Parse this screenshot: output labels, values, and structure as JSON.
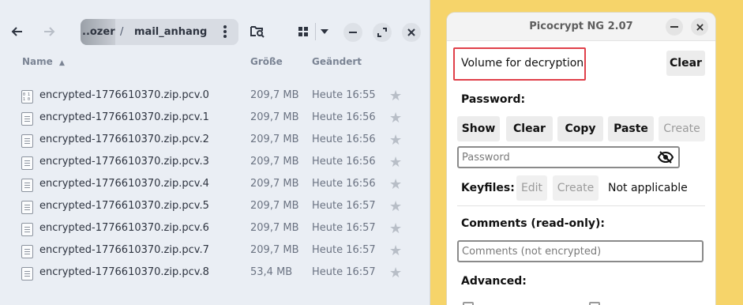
{
  "file_manager": {
    "breadcrumb": {
      "parent": "..ozer",
      "separator": "/",
      "current": "mail_anhang"
    },
    "icons": {
      "back": "arrow-left-icon",
      "forward": "arrow-right-icon",
      "menu": "kebab-menu-icon",
      "search": "search-folder-icon",
      "view": "grid-view-icon",
      "view_dropdown": "chevron-down-icon",
      "minimize": "minimize-icon",
      "maximize": "maximize-icon",
      "close": "close-icon"
    },
    "columns": {
      "name": "Name",
      "size": "Größe",
      "modified": "Geändert",
      "sort_indicator": "▲"
    },
    "files": [
      {
        "name": "encrypted-1776610370.zip.pcv.0",
        "size": "209,7 MB",
        "modified": "Heute 16:55",
        "icon": "binary-file-icon"
      },
      {
        "name": "encrypted-1776610370.zip.pcv.1",
        "size": "209,7 MB",
        "modified": "Heute 16:56",
        "icon": "text-file-icon"
      },
      {
        "name": "encrypted-1776610370.zip.pcv.2",
        "size": "209,7 MB",
        "modified": "Heute 16:56",
        "icon": "text-file-icon"
      },
      {
        "name": "encrypted-1776610370.zip.pcv.3",
        "size": "209,7 MB",
        "modified": "Heute 16:56",
        "icon": "text-file-icon"
      },
      {
        "name": "encrypted-1776610370.zip.pcv.4",
        "size": "209,7 MB",
        "modified": "Heute 16:56",
        "icon": "text-file-icon"
      },
      {
        "name": "encrypted-1776610370.zip.pcv.5",
        "size": "209,7 MB",
        "modified": "Heute 16:57",
        "icon": "text-file-icon"
      },
      {
        "name": "encrypted-1776610370.zip.pcv.6",
        "size": "209,7 MB",
        "modified": "Heute 16:57",
        "icon": "text-file-icon"
      },
      {
        "name": "encrypted-1776610370.zip.pcv.7",
        "size": "209,7 MB",
        "modified": "Heute 16:57",
        "icon": "text-file-icon"
      },
      {
        "name": "encrypted-1776610370.zip.pcv.8",
        "size": "53,4 MB",
        "modified": "Heute 16:57",
        "icon": "text-file-icon"
      }
    ]
  },
  "picocrypt": {
    "title": "Picocrypt NG 2.07",
    "volume_label": "Volume for decryption",
    "clear_label": "Clear",
    "password_heading": "Password:",
    "password_buttons": {
      "show": "Show",
      "clear": "Clear",
      "copy": "Copy",
      "paste": "Paste",
      "create": "Create"
    },
    "password_placeholder": "Password",
    "keyfiles_label": "Keyfiles:",
    "keyfiles_edit": "Edit",
    "keyfiles_create": "Create",
    "keyfiles_status": "Not applicable",
    "comments_heading": "Comments (read-only):",
    "comments_placeholder": "Comments (not encrypted)",
    "advanced_heading": "Advanced:",
    "highlight_color": "#e0404a"
  }
}
